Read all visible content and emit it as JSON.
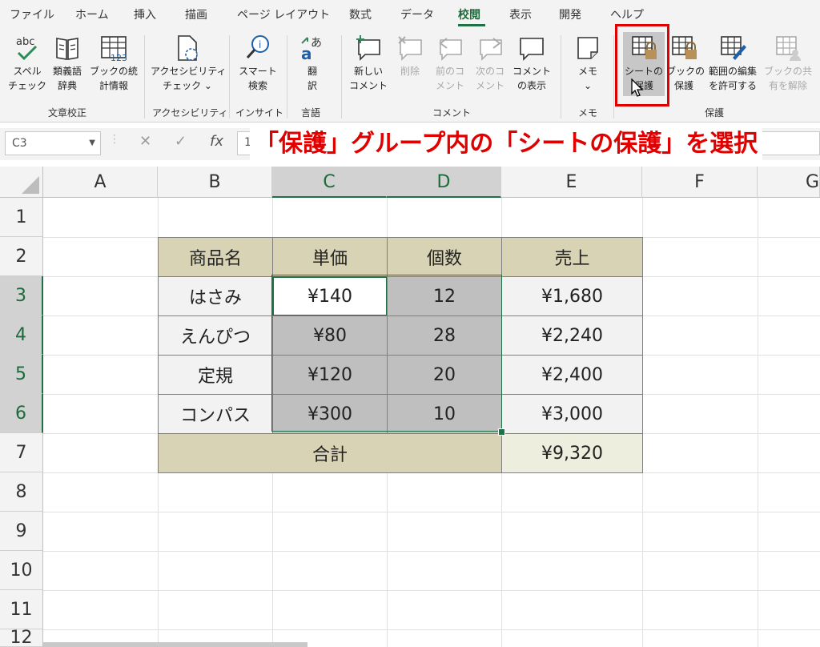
{
  "tabs": [
    "ファイル",
    "ホーム",
    "挿入",
    "描画",
    "ページ レイアウト",
    "数式",
    "データ",
    "校閲",
    "表示",
    "開発",
    "ヘルプ"
  ],
  "active_tab": "校閲",
  "ribbon": {
    "spell_check": [
      "スペル",
      "チェック"
    ],
    "thesaurus": [
      "類義語",
      "辞典"
    ],
    "workbook_stats": [
      "ブックの統",
      "計情報"
    ],
    "accessibility": [
      "アクセシビリティ",
      "チェック ⌄"
    ],
    "smart_lookup": [
      "スマート",
      "検索"
    ],
    "translate": [
      "翻",
      "訳"
    ],
    "new_comment": [
      "新しい",
      "コメント"
    ],
    "delete_comment": [
      "削除"
    ],
    "prev_comment": [
      "前のコ",
      "メント"
    ],
    "next_comment": [
      "次のコ",
      "メント"
    ],
    "show_comments": [
      "コメント",
      "の表示"
    ],
    "notes": [
      "メモ",
      "⌄"
    ],
    "protect_sheet": [
      "シートの",
      "保護"
    ],
    "protect_workbook": [
      "ブックの",
      "保護"
    ],
    "allow_edit_ranges": [
      "範囲の編集",
      "を許可する"
    ],
    "unshare_workbook": [
      "ブックの共",
      "有を解除"
    ],
    "groups": {
      "proofing": "文章校正",
      "accessibility": "アクセシビリティ",
      "insights": "インサイト",
      "language": "言語",
      "comments": "コメント",
      "notes": "メモ",
      "protect": "保護"
    }
  },
  "formula_bar": {
    "name_box": "C3",
    "fx": "fx",
    "value": "140"
  },
  "callout": "「保護」グループ内の「シートの保護」を選択",
  "columns": [
    "A",
    "B",
    "C",
    "D",
    "E",
    "F",
    "G"
  ],
  "rows": [
    "1",
    "2",
    "3",
    "4",
    "5",
    "6",
    "7",
    "8",
    "9",
    "10",
    "11",
    "12"
  ],
  "table": {
    "headers": [
      "商品名",
      "単価",
      "個数",
      "売上"
    ],
    "rows": [
      [
        "はさみ",
        "¥140",
        "12",
        "¥1,680"
      ],
      [
        "えんぴつ",
        "¥80",
        "28",
        "¥2,240"
      ],
      [
        "定規",
        "¥120",
        "20",
        "¥2,400"
      ],
      [
        "コンパス",
        "¥300",
        "10",
        "¥3,000"
      ]
    ],
    "total_label": "合計",
    "total_value": "¥9,320"
  },
  "colors": {
    "accent": "#1e7145",
    "header_fill": "#d8d3b4",
    "selection_fill": "#bfbfbf",
    "callout": "#e00000"
  }
}
